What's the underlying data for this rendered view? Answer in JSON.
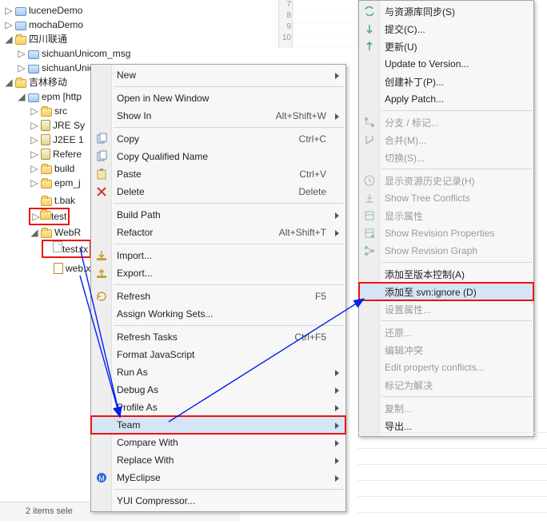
{
  "tree": {
    "projects": [
      {
        "twisty": "▷",
        "icon": "pkg",
        "label": "luceneDemo"
      },
      {
        "twisty": "▷",
        "icon": "pkg",
        "label": "mochaDemo"
      },
      {
        "twisty": "◢",
        "icon": "folder",
        "label": "四川联通",
        "children": [
          {
            "twisty": "▷",
            "icon": "pkg",
            "label": "sichuanUnicom_msg"
          },
          {
            "twisty": "▷",
            "icon": "pkg",
            "label": "sichuanUnicom"
          }
        ]
      },
      {
        "twisty": "◢",
        "icon": "folder",
        "label": "吉林移动",
        "children": [
          {
            "twisty": "◢",
            "icon": "pkg",
            "label": "epm  [http",
            "children": [
              {
                "twisty": "▷",
                "icon": "folder",
                "label": "src"
              },
              {
                "twisty": "▷",
                "icon": "jar",
                "label": "JRE Sy"
              },
              {
                "twisty": "▷",
                "icon": "jar",
                "label": "J2EE 1"
              },
              {
                "twisty": "▷",
                "icon": "jar",
                "label": "Refere"
              },
              {
                "twisty": "▷",
                "icon": "folder",
                "label": "build"
              },
              {
                "twisty": "▷",
                "icon": "folder",
                "label": "epm_j"
              },
              {
                "twisty": "",
                "icon": "folder",
                "label": "t.bak"
              },
              {
                "twisty": "▷",
                "icon": "folder",
                "label": "test",
                "hl": true
              },
              {
                "twisty": "◢",
                "icon": "folder",
                "label": "WebR",
                "children": [
                  {
                    "twisty": "",
                    "icon": "file",
                    "label": "test.tx",
                    "hl": true
                  },
                  {
                    "twisty": "",
                    "icon": "xml",
                    "label": "web.x"
                  }
                ]
              }
            ]
          }
        ]
      }
    ]
  },
  "ruler": {
    "numbers": [
      "7",
      "8",
      "9",
      "10"
    ]
  },
  "status": "2 items sele",
  "menu1": {
    "items": [
      {
        "label": "New",
        "submenu": true
      },
      {
        "sep": true
      },
      {
        "label": "Open in New Window"
      },
      {
        "label": "Show In",
        "accel": "Alt+Shift+W",
        "submenu": true
      },
      {
        "sep": true
      },
      {
        "label": "Copy",
        "accel": "Ctrl+C",
        "icon": "copy"
      },
      {
        "label": "Copy Qualified Name",
        "icon": "copyq"
      },
      {
        "label": "Paste",
        "accel": "Ctrl+V",
        "icon": "paste"
      },
      {
        "label": "Delete",
        "accel": "Delete",
        "icon": "delete"
      },
      {
        "sep": true
      },
      {
        "label": "Build Path",
        "submenu": true
      },
      {
        "label": "Refactor",
        "accel": "Alt+Shift+T",
        "submenu": true
      },
      {
        "sep": true
      },
      {
        "label": "Import...",
        "icon": "import"
      },
      {
        "label": "Export...",
        "icon": "export"
      },
      {
        "sep": true
      },
      {
        "label": "Refresh",
        "accel": "F5",
        "icon": "refresh"
      },
      {
        "label": "Assign Working Sets..."
      },
      {
        "sep": true
      },
      {
        "label": "Refresh Tasks",
        "accel": "Ctrl+F5"
      },
      {
        "label": "Format JavaScript"
      },
      {
        "label": "Run As",
        "submenu": true
      },
      {
        "label": "Debug As",
        "submenu": true
      },
      {
        "label": "Profile As",
        "submenu": true
      },
      {
        "label": "Team",
        "submenu": true,
        "hover": true,
        "hl": true
      },
      {
        "label": "Compare With",
        "submenu": true
      },
      {
        "label": "Replace With",
        "submenu": true
      },
      {
        "label": "MyEclipse",
        "submenu": true,
        "icon": "myeclipse"
      },
      {
        "sep": true
      },
      {
        "label": "YUI Compressor..."
      }
    ]
  },
  "menu2": {
    "items": [
      {
        "label": "与资源库同步(S)",
        "icon": "sync"
      },
      {
        "label": "提交(C)...",
        "icon": "commit"
      },
      {
        "label": "更新(U)",
        "icon": "update"
      },
      {
        "label": "Update to Version..."
      },
      {
        "label": "创建补丁(P)..."
      },
      {
        "label": "Apply Patch..."
      },
      {
        "sep": true
      },
      {
        "label": "分支 / 标记...",
        "disabled": true,
        "icon": "branch"
      },
      {
        "label": "合并(M)...",
        "disabled": true,
        "icon": "merge"
      },
      {
        "label": "切换(S)...",
        "disabled": true
      },
      {
        "sep": true
      },
      {
        "label": "显示资源历史记录(H)",
        "disabled": true,
        "icon": "history"
      },
      {
        "label": "Show Tree Conflicts",
        "disabled": true,
        "icon": "treeconf"
      },
      {
        "label": "显示属性",
        "disabled": true,
        "icon": "props"
      },
      {
        "label": "Show Revision Properties",
        "disabled": true,
        "icon": "revprops"
      },
      {
        "label": "Show Revision Graph",
        "disabled": true,
        "icon": "revgraph"
      },
      {
        "sep": true
      },
      {
        "label": "添加至版本控制(A)"
      },
      {
        "label": "添加至 svn:ignore (D)",
        "hover": true,
        "hl": true
      },
      {
        "label": "设置属性...",
        "disabled": true
      },
      {
        "sep": true
      },
      {
        "label": "还原...",
        "disabled": true
      },
      {
        "label": "编辑冲突",
        "disabled": true
      },
      {
        "label": "Edit property conflicts...",
        "disabled": true
      },
      {
        "label": "标记为解决",
        "disabled": true
      },
      {
        "sep": true
      },
      {
        "label": "复制...",
        "disabled": true
      },
      {
        "label": "导出..."
      }
    ]
  }
}
